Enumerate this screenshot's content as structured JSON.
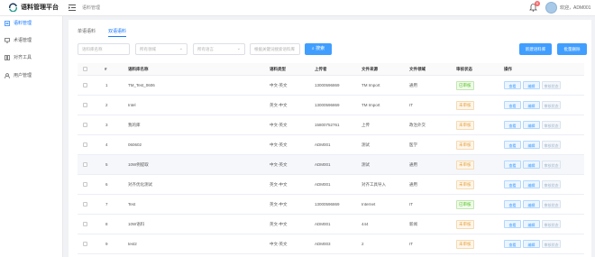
{
  "app": {
    "title": "语料管理平台",
    "breadcrumb": "语料管理"
  },
  "header": {
    "notification_count": "6",
    "user_greeting": "欢迎，ADM001"
  },
  "sidebar": {
    "items": [
      {
        "label": "语料管理",
        "icon": "document-icon",
        "active": true
      },
      {
        "label": "术语管理",
        "icon": "monitor-icon",
        "active": false
      },
      {
        "label": "对齐工具",
        "icon": "align-icon",
        "active": false
      },
      {
        "label": "用户管理",
        "icon": "user-icon",
        "active": false
      }
    ]
  },
  "tabs": [
    {
      "label": "单语语料",
      "active": false
    },
    {
      "label": "双语语料",
      "active": true
    }
  ],
  "filters": {
    "name_placeholder": "语料库名称",
    "domain_placeholder": "所有领域",
    "language_placeholder": "所有语言",
    "uploader_placeholder": "根据关键词搜索语料库",
    "search_label": "搜索"
  },
  "actions": {
    "new_label": "新建语料库",
    "batch_delete_label": "批量删除"
  },
  "table": {
    "columns": [
      "#",
      "语料库名称",
      "语料类型",
      "上传者",
      "文件来源",
      "文件领域",
      "审核状态",
      "操作"
    ],
    "rows": [
      {
        "no": "1",
        "name": "TM_Test_0606",
        "type": "中文-英文",
        "uploader": "13000596869",
        "source": "TM Import",
        "domain": "通用",
        "status": "已审核",
        "status_kind": "ok"
      },
      {
        "no": "2",
        "name": "Intel",
        "type": "英文-中文",
        "uploader": "13000596869",
        "source": "TM Import",
        "domain": "IT",
        "status": "未审核",
        "status_kind": "pending"
      },
      {
        "no": "3",
        "name": "我的库",
        "type": "中文-英文",
        "uploader": "15800752761",
        "source": "上传",
        "domain": "政治外交",
        "status": "未审核",
        "status_kind": "pending"
      },
      {
        "no": "4",
        "name": "060602",
        "type": "中文-英文",
        "uploader": "ADM001",
        "source": "测试",
        "domain": "医学",
        "status": "未审核",
        "status_kind": "pending"
      },
      {
        "no": "5",
        "name": "10W例提取",
        "type": "中文-英文",
        "uploader": "ADM001",
        "source": "测试",
        "domain": "通用",
        "status": "未审核",
        "status_kind": "pending"
      },
      {
        "no": "6",
        "name": "对齐优化测试",
        "type": "英文-中文",
        "uploader": "ADM001",
        "source": "对齐工具导入",
        "domain": "通用",
        "status": "未审核",
        "status_kind": "pending"
      },
      {
        "no": "7",
        "name": "Test",
        "type": "英文-中文",
        "uploader": "13000596869",
        "source": "Internet",
        "domain": "IT",
        "status": "已审核",
        "status_kind": "ok"
      },
      {
        "no": "8",
        "name": "10W语料",
        "type": "英文-中文",
        "uploader": "ADM001",
        "source": "444",
        "domain": "新闻",
        "status": "未审核",
        "status_kind": "pending"
      },
      {
        "no": "9",
        "name": "test2",
        "type": "中文-英文",
        "uploader": "ADM003",
        "source": "2",
        "domain": "IT",
        "status": "未审核",
        "status_kind": "pending"
      }
    ],
    "op_labels": {
      "view": "查看",
      "edit": "编辑",
      "audit": "审核状态"
    }
  },
  "colors": {
    "accent": "#409eff",
    "approved": "#52c41a",
    "pending": "#e6a23c"
  }
}
